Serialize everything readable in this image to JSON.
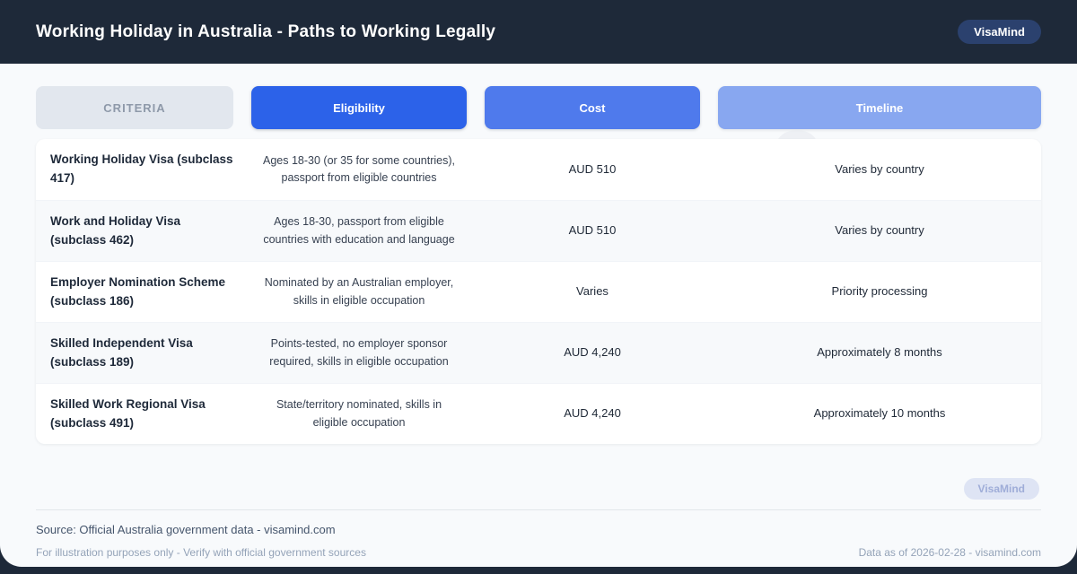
{
  "header": {
    "title": "Working Holiday in Australia - Paths to Working Legally",
    "brand_badge": "VisaMind"
  },
  "columns": [
    {
      "id": "criteria",
      "label": "CRITERIA",
      "bg": "#e2e7ee",
      "text_color": "#8e99a9"
    },
    {
      "id": "eligibility",
      "label": "Eligibility",
      "bg": "#2c62e9",
      "text_color": "#ffffff"
    },
    {
      "id": "cost",
      "label": "Cost",
      "bg": "#4f7aec",
      "text_color": "#ffffff"
    },
    {
      "id": "timeline",
      "label": "Timeline",
      "bg": "#88a7f0",
      "text_color": "#ffffff"
    }
  ],
  "rows": [
    {
      "criteria": "Working Holiday Visa (subclass 417)",
      "eligibility": "Ages 18-30 (or 35 for some countries), passport from eligible countries",
      "cost": "AUD 510",
      "timeline": "Varies by country"
    },
    {
      "criteria": "Work and Holiday Visa (subclass 462)",
      "eligibility": "Ages 18-30, passport from eligible countries with education and language",
      "cost": "AUD 510",
      "timeline": "Varies by country"
    },
    {
      "criteria": "Employer Nomination Scheme (subclass 186)",
      "eligibility": "Nominated by an Australian employer, skills in eligible occupation",
      "cost": "Varies",
      "timeline": "Priority processing"
    },
    {
      "criteria": "Skilled Independent Visa (subclass 189)",
      "eligibility": "Points-tested, no employer sponsor required, skills in eligible occupation",
      "cost": "AUD 4,240",
      "timeline": "Approximately 8 months"
    },
    {
      "criteria": "Skilled Work Regional Visa (subclass 491)",
      "eligibility": "State/territory nominated, skills in eligible occupation",
      "cost": "AUD 4,240",
      "timeline": "Approximately 10 months"
    }
  ],
  "footer": {
    "brand_badge": "VisaMind",
    "source": "Source: Official Australia government data - visamind.com",
    "disclaimer": "For illustration purposes only - Verify with official government sources",
    "data_as_of": "Data as of 2026-02-28 - visamind.com"
  },
  "colors": {
    "header_bg": "#1e2939",
    "panel_bg": "#f8fafc",
    "brand_pill_bg": "#2b416e",
    "eligibility_blue": "#2c62e9",
    "cost_blue": "#4f7aec",
    "timeline_blue": "#88a7f0",
    "criteria_gray": "#e2e7ee",
    "row_alt_bg": "#f7f9fb",
    "footer_pill_bg": "#dee4f4",
    "footer_pill_text": "#9fadd8"
  }
}
